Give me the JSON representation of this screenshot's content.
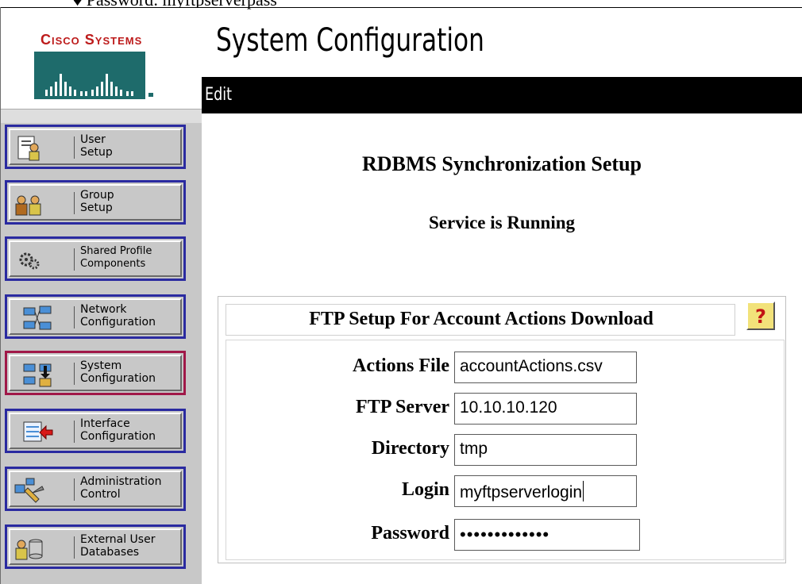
{
  "top_note": "♦ Password: myftpserverpass",
  "brand": {
    "company": "Cisco Systems"
  },
  "nav": {
    "items": [
      {
        "label": "User\nSetup"
      },
      {
        "label": "Group\nSetup"
      },
      {
        "label": "Shared Profile\nComponents"
      },
      {
        "label": "Network\nConfiguration"
      },
      {
        "label": "System\nConfiguration",
        "active": true
      },
      {
        "label": "Interface\nConfiguration"
      },
      {
        "label": "Administration\nControl"
      },
      {
        "label": "External User\nDatabases"
      }
    ]
  },
  "header": {
    "title": "System Configuration",
    "edit_label": "Edit"
  },
  "main": {
    "section_title": "RDBMS Synchronization Setup",
    "status": "Service is Running",
    "ftp_setup": {
      "title": "FTP Setup For Account Actions Download",
      "help_label": "?",
      "fields": [
        {
          "label": "Actions File",
          "value": "accountActions.csv"
        },
        {
          "label": "FTP Server",
          "value": "10.10.10.120"
        },
        {
          "label": "Directory",
          "value": "tmp"
        },
        {
          "label": "Login",
          "value": "myftpserverlogin"
        },
        {
          "label": "Password",
          "value": "•••••••••••••"
        }
      ]
    }
  },
  "colors": {
    "edit_bar": "#000000",
    "nav_border": "#2a2aa0",
    "nav_active_border": "#a01848",
    "logo_red": "#bd1b1b",
    "logo_teal": "#1e6b6b"
  }
}
